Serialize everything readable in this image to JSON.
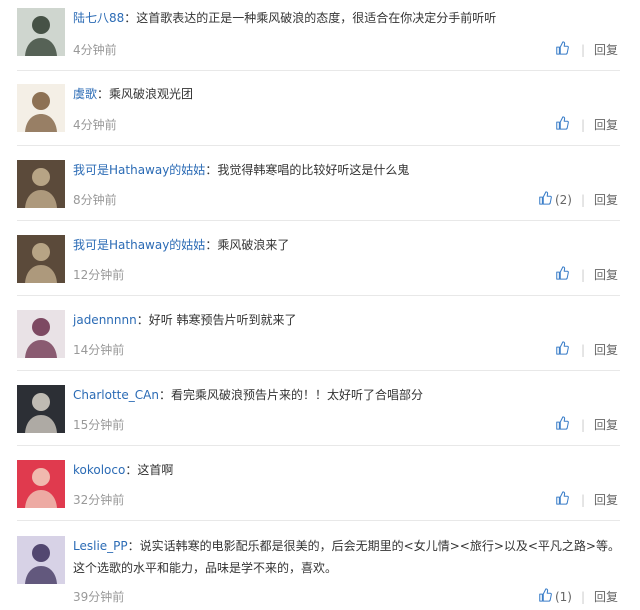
{
  "comments": [
    {
      "user": "陆七八88",
      "text": "这首歌表达的正是一种乘风破浪的态度，很适合在你决定分手前听听",
      "time": "4分钟前",
      "likes": "",
      "reply": "回复",
      "avatar_colors": [
        "#cfd6cf",
        "#2e3b2e"
      ]
    },
    {
      "user": "虞歌",
      "text": "乘风破浪观光团",
      "time": "4分钟前",
      "likes": "",
      "reply": "回复",
      "avatar_colors": [
        "#f4efe6",
        "#7a5a3a"
      ]
    },
    {
      "user": "我可是Hathaway的姑姑",
      "text": "我觉得韩寒唱的比较好听这是什么鬼",
      "time": "8分钟前",
      "likes": "(2)",
      "reply": "回复",
      "avatar_colors": [
        "#5b4a3a",
        "#c8b493"
      ]
    },
    {
      "user": "我可是Hathaway的姑姑",
      "text": "乘风破浪来了",
      "time": "12分钟前",
      "likes": "",
      "reply": "回复",
      "avatar_colors": [
        "#5b4a3a",
        "#c8b493"
      ]
    },
    {
      "user": "jadennnnn",
      "text": "好听 韩寒预告片听到就来了",
      "time": "14分钟前",
      "likes": "",
      "reply": "回复",
      "avatar_colors": [
        "#e9e2e6",
        "#6a2e4a"
      ]
    },
    {
      "user": "Charlotte_CAn",
      "text": "看完乘风破浪预告片来的！！太好听了合唱部分",
      "time": "15分钟前",
      "likes": "",
      "reply": "回复",
      "avatar_colors": [
        "#2c2f35",
        "#d9d4c9"
      ]
    },
    {
      "user": "kokoloco",
      "text": "这首啊",
      "time": "32分钟前",
      "likes": "",
      "reply": "回复",
      "avatar_colors": [
        "#e03a4e",
        "#f2d0c0"
      ]
    },
    {
      "user": "Leslie_PP",
      "text": "说实话韩寒的电影配乐都是很美的，后会无期里的<女儿情><旅行>以及<平凡之路>等。这个选歌的水平和能力，品味是学不来的，喜欢。",
      "time": "39分钟前",
      "likes": "(1)",
      "reply": "回复",
      "avatar_colors": [
        "#d7d2e6",
        "#3b2f5a"
      ]
    }
  ],
  "colors": {
    "username": "#2b6bb5",
    "like_icon": "#3d7fc9",
    "time": "#999999"
  }
}
